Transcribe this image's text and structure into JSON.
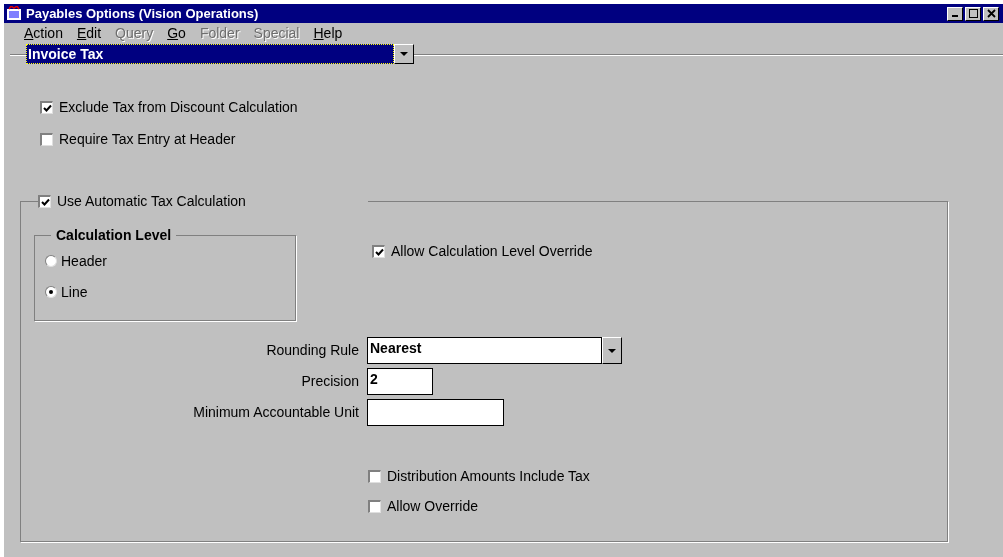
{
  "window": {
    "title": "Payables Options (Vision Operations)"
  },
  "menu": [
    {
      "label": "Action",
      "disabled": false
    },
    {
      "label": "Edit",
      "disabled": false
    },
    {
      "label": "Query",
      "disabled": true
    },
    {
      "label": "Go",
      "disabled": false
    },
    {
      "label": "Folder",
      "disabled": true
    },
    {
      "label": "Special",
      "disabled": true
    },
    {
      "label": "Help",
      "disabled": false
    }
  ],
  "region": {
    "value": "Invoice Tax"
  },
  "checkboxes": [
    {
      "label": "Exclude Tax from Discount Calculation",
      "checked": true
    },
    {
      "label": "Require Tax Entry at Header",
      "checked": false
    }
  ],
  "automatic_tax": {
    "label": "Use Automatic Tax Calculation",
    "checked": true,
    "calculation_level": {
      "title": "Calculation Level",
      "options": [
        {
          "label": "Header",
          "selected": false
        },
        {
          "label": "Line",
          "selected": true
        }
      ]
    },
    "allow_level_override": {
      "label": "Allow Calculation Level Override",
      "checked": true
    },
    "fields": [
      {
        "kind": "dropdown",
        "label": "Rounding Rule",
        "value": "Nearest"
      },
      {
        "kind": "short",
        "label": "Precision",
        "value": "2"
      },
      {
        "kind": "text",
        "label": "Minimum Accountable Unit"
      }
    ],
    "options": [
      {
        "label": "Distribution Amounts Include Tax",
        "checked": false
      },
      {
        "label": "Allow Override",
        "checked": false
      }
    ]
  }
}
